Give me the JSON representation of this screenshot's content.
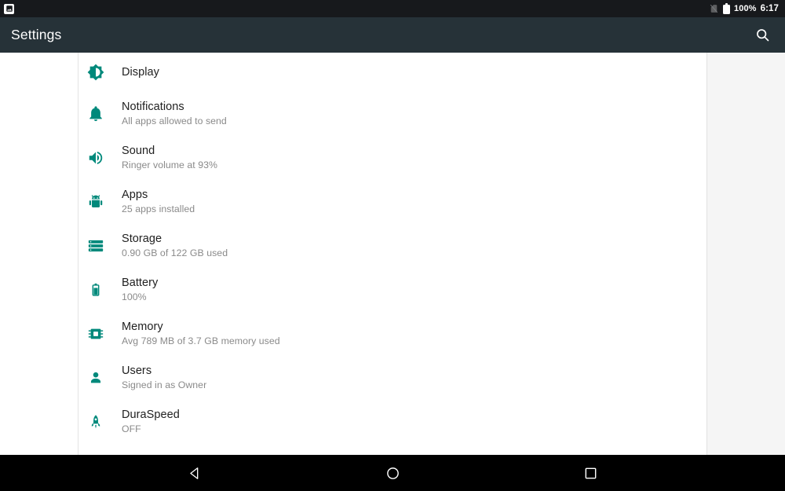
{
  "status_bar": {
    "notification_icon": "photo-icon",
    "no_sim_icon": "sim-off-icon",
    "battery_icon": "battery-full-icon",
    "battery_percent": "100%",
    "time": "6:17"
  },
  "app_bar": {
    "title": "Settings",
    "search_icon": "search-icon"
  },
  "theme": {
    "accent": "#00897B",
    "app_bar_bg": "#263238",
    "status_bar_bg": "#17191C",
    "title_color": "#212121",
    "subtitle_color": "#8A8A8A"
  },
  "settings": {
    "items": [
      {
        "icon": "brightness-icon",
        "title": "Display",
        "subtitle": ""
      },
      {
        "icon": "bell-icon",
        "title": "Notifications",
        "subtitle": "All apps allowed to send"
      },
      {
        "icon": "speaker-icon",
        "title": "Sound",
        "subtitle": "Ringer volume at 93%"
      },
      {
        "icon": "android-icon",
        "title": "Apps",
        "subtitle": "25 apps installed"
      },
      {
        "icon": "storage-icon",
        "title": "Storage",
        "subtitle": "0.90 GB of 122 GB used"
      },
      {
        "icon": "battery-icon",
        "title": "Battery",
        "subtitle": "100%"
      },
      {
        "icon": "memory-chip-icon",
        "title": "Memory",
        "subtitle": "Avg 789 MB of 3.7 GB memory used"
      },
      {
        "icon": "person-icon",
        "title": "Users",
        "subtitle": "Signed in as Owner"
      },
      {
        "icon": "rocket-icon",
        "title": "DuraSpeed",
        "subtitle": "OFF"
      }
    ]
  },
  "nav_bar": {
    "back_label": "back-icon",
    "home_label": "home-icon",
    "recents_label": "recents-icon"
  }
}
